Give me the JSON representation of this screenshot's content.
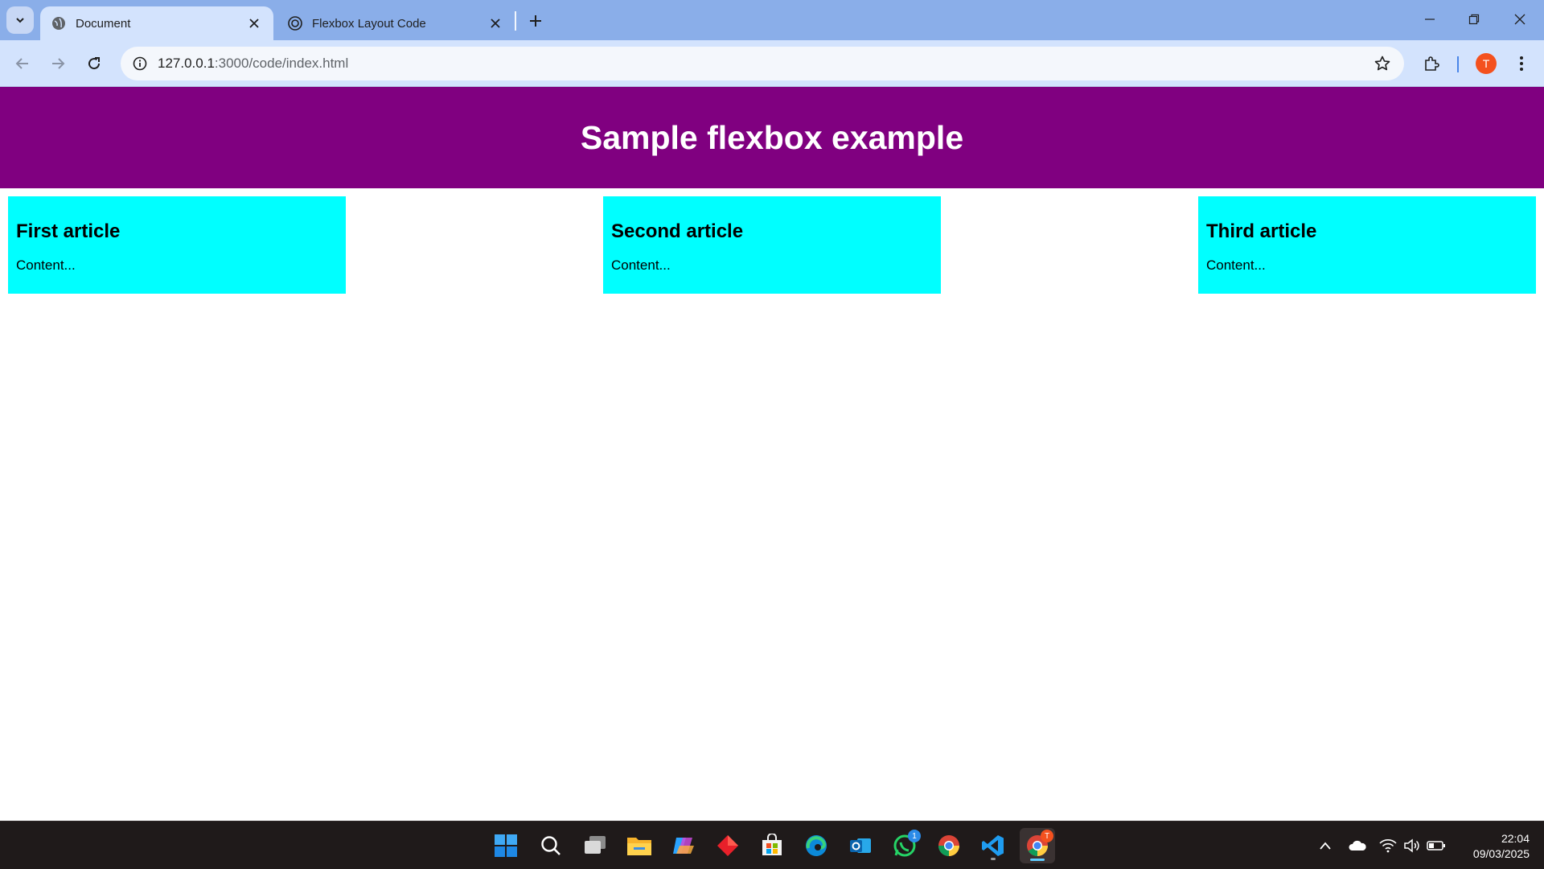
{
  "browser": {
    "tabs": [
      {
        "title": "Document",
        "favicon": "globe-icon",
        "active": true
      },
      {
        "title": "Flexbox Layout Code",
        "favicon": "openai-icon",
        "active": false
      }
    ],
    "url_host": "127.0.0.1",
    "url_rest": ":3000/code/index.html",
    "profile_initial": "T"
  },
  "page": {
    "title": "Sample flexbox example",
    "header_color": "#800080",
    "article_color": "#00ffff",
    "articles": [
      {
        "heading": "First article",
        "content": "Content..."
      },
      {
        "heading": "Second article",
        "content": "Content..."
      },
      {
        "heading": "Third article",
        "content": "Content..."
      }
    ]
  },
  "taskbar": {
    "apps": [
      {
        "name": "start-icon"
      },
      {
        "name": "search-icon"
      },
      {
        "name": "task-view-icon"
      },
      {
        "name": "file-explorer-icon"
      },
      {
        "name": "copilot-icon"
      },
      {
        "name": "red-diamond-app-icon"
      },
      {
        "name": "microsoft-store-icon"
      },
      {
        "name": "edge-icon"
      },
      {
        "name": "outlook-icon"
      },
      {
        "name": "whatsapp-icon",
        "badge": "1"
      },
      {
        "name": "chrome-icon"
      },
      {
        "name": "vscode-icon"
      },
      {
        "name": "chrome-profile-icon",
        "badge": "T"
      }
    ],
    "time": "22:04",
    "date": "09/03/2025"
  }
}
